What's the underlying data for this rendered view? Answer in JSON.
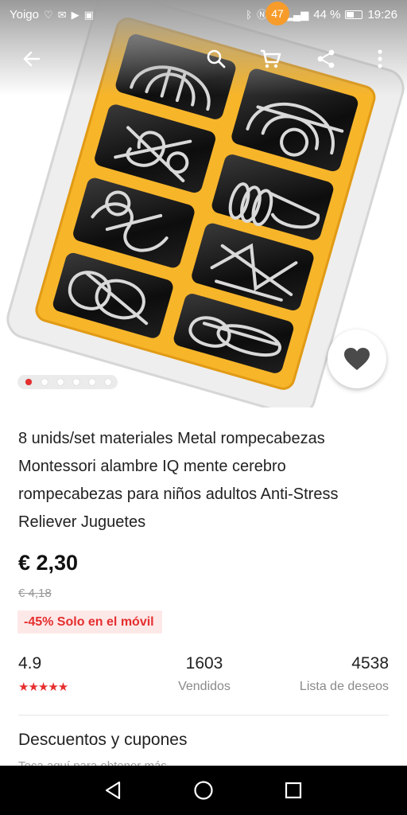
{
  "status_bar": {
    "carrier": "Yoigo",
    "battery": "44 %",
    "time": "19:26",
    "battery_level": 0.44
  },
  "toolbar": {
    "cart_count": "47",
    "icons": [
      "back-arrow-icon",
      "search-icon",
      "cart-icon",
      "share-icon",
      "more-vertical-icon"
    ]
  },
  "gallery": {
    "image_count": 6,
    "active_index": 0,
    "colors": {
      "tray": "#f7b52a",
      "active_dot": "#e62e2e"
    }
  },
  "product": {
    "title": "8 unids/set materiales Metal rompecabezas Montessori alambre IQ mente cerebro rompecabezas para niños adultos Anti-Stress Reliever Juguetes",
    "price": "€ 2,30",
    "old_price": "€ 4,18",
    "promo": "-45% Solo en el móvil"
  },
  "stats": {
    "rating": {
      "value": "4.9",
      "stars": "★★★★★"
    },
    "sold": {
      "value": "1603",
      "label": "Vendidos"
    },
    "wishlist": {
      "value": "4538",
      "label": "Lista de deseos"
    }
  },
  "coupons": {
    "title": "Descuentos y cupones",
    "subtitle": "Toca aquí para obtener más"
  },
  "colors": {
    "accent": "#e62e2e",
    "badge": "#f79c2a"
  }
}
